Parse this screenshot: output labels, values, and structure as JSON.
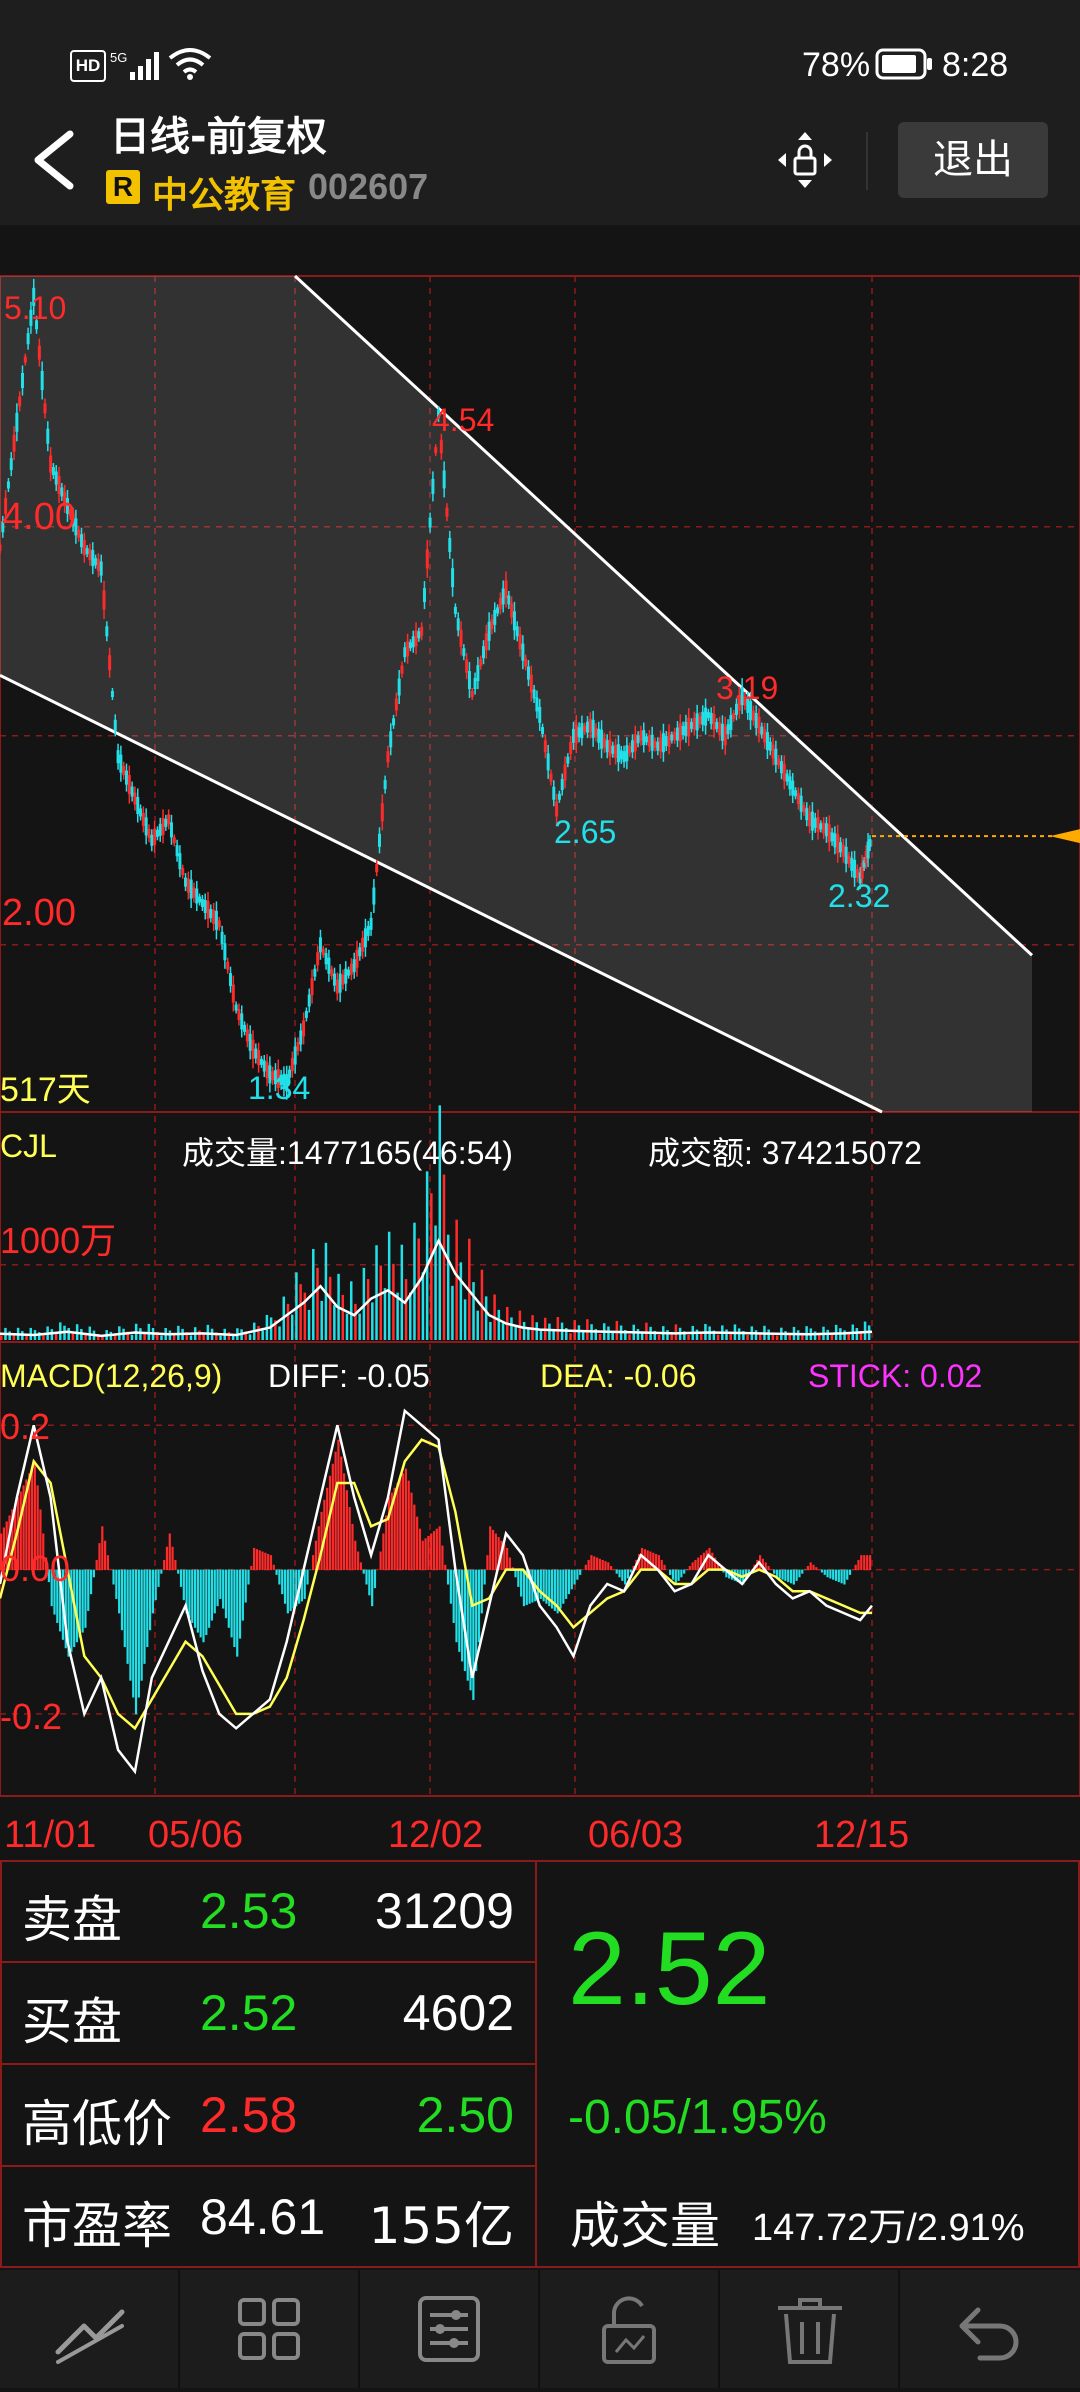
{
  "status_bar": {
    "left_icons": [
      "hd-icon",
      "5g-signal-icon",
      "wifi-icon"
    ],
    "battery_text": "78%",
    "time": "8:28"
  },
  "header": {
    "title": "日线-前复权",
    "badge": "R",
    "stock_name": "中公教育",
    "stock_code": "002607",
    "exit_label": "退出"
  },
  "colors": {
    "up": "#ff2a2a",
    "down": "#22e0e8",
    "green": "#22dd22",
    "yellow": "#ffff55",
    "magenta": "#ff33ff",
    "grid": "#8b1a1a",
    "price_line": "#ffaa00"
  },
  "chart_data": [
    {
      "type": "line",
      "title": "日线-前复权",
      "y_ticks": [
        "4.00",
        "2.00"
      ],
      "ylim": [
        1.2,
        5.2
      ],
      "annotations": [
        "5.10",
        "4.54",
        "3.19",
        "2.65",
        "2.32",
        "1.34"
      ],
      "span_label": "517天",
      "x_ticks": [
        "11/01",
        "05/06",
        "12/02",
        "06/03",
        "12/15"
      ],
      "series": [
        {
          "name": "",
          "x": [
            0,
            10,
            20,
            30,
            40,
            50,
            60,
            70,
            80,
            90,
            100,
            110,
            120,
            130,
            140,
            150,
            160,
            170,
            180,
            190,
            200,
            210,
            220,
            230,
            240,
            250,
            260,
            270,
            280,
            290,
            300,
            310,
            320,
            330,
            340,
            350,
            360,
            370,
            380,
            390,
            400,
            410,
            420,
            430,
            440,
            450,
            460,
            470,
            480,
            490,
            500,
            510,
            517
          ],
          "y": [
            3.9,
            4.5,
            5.1,
            4.3,
            4.1,
            3.9,
            3.8,
            2.9,
            2.7,
            2.5,
            2.6,
            2.3,
            2.2,
            2.1,
            1.7,
            1.5,
            1.38,
            1.34,
            1.6,
            2.0,
            1.8,
            1.9,
            2.1,
            2.9,
            3.4,
            3.5,
            4.54,
            3.6,
            3.2,
            3.5,
            3.7,
            3.4,
            3.1,
            2.65,
            3.0,
            3.05,
            2.95,
            2.9,
            3.0,
            2.95,
            3.0,
            3.05,
            3.1,
            3.0,
            3.19,
            3.05,
            2.9,
            2.75,
            2.6,
            2.55,
            2.45,
            2.32,
            2.52
          ]
        }
      ],
      "channel": {
        "upper": {
          "start": [
            0,
            5.25
          ],
          "end": [
            517,
            1.95
          ]
        },
        "lower": {
          "start": [
            0,
            3.05
          ],
          "end": [
            517,
            0.7
          ]
        }
      },
      "current_price": 2.52
    },
    {
      "type": "bar",
      "title": "CJL",
      "volume_label": "成交量:1477165(46:54)",
      "amount_label": "成交额: 374215072",
      "y_tick": "1000万",
      "ylim": [
        0,
        2500
      ],
      "x": [
        0,
        20,
        40,
        60,
        80,
        100,
        120,
        140,
        160,
        180,
        190,
        200,
        210,
        220,
        230,
        240,
        250,
        260,
        270,
        280,
        290,
        300,
        310,
        320,
        340,
        360,
        380,
        400,
        420,
        440,
        460,
        480,
        500,
        517
      ],
      "values": [
        150,
        120,
        200,
        100,
        180,
        140,
        160,
        120,
        300,
        900,
        1300,
        800,
        600,
        1000,
        1200,
        900,
        1500,
        2400,
        1600,
        1100,
        600,
        400,
        300,
        250,
        220,
        200,
        180,
        160,
        180,
        170,
        150,
        140,
        160,
        200
      ]
    },
    {
      "type": "bar",
      "title": "MACD(12,26,9)",
      "diff_label": "DIFF: -0.05",
      "dea_label": "DEA: -0.06",
      "stick_label": "STICK: 0.02",
      "y_ticks": [
        "0.2",
        "0.00",
        "-0.2"
      ],
      "ylim": [
        -0.3,
        0.26
      ],
      "x": [
        0,
        10,
        20,
        30,
        40,
        50,
        60,
        70,
        80,
        90,
        100,
        110,
        120,
        130,
        140,
        150,
        160,
        170,
        180,
        190,
        200,
        210,
        220,
        230,
        240,
        250,
        260,
        270,
        280,
        290,
        300,
        310,
        320,
        330,
        340,
        350,
        360,
        370,
        380,
        390,
        400,
        410,
        420,
        430,
        440,
        450,
        460,
        470,
        480,
        490,
        500,
        510,
        517
      ],
      "stick": [
        0.05,
        0.1,
        0.15,
        -0.05,
        -0.12,
        -0.08,
        0.06,
        -0.06,
        -0.2,
        -0.06,
        0.05,
        -0.06,
        -0.1,
        -0.04,
        -0.12,
        0.03,
        0.02,
        -0.06,
        -0.04,
        0.08,
        0.18,
        0.04,
        -0.05,
        0.1,
        0.14,
        0.04,
        0.06,
        -0.1,
        -0.18,
        0.06,
        0.03,
        -0.05,
        -0.04,
        -0.06,
        -0.02,
        0.02,
        0.01,
        -0.02,
        0.03,
        0.02,
        -0.02,
        0.01,
        0.03,
        -0.01,
        -0.02,
        0.02,
        -0.01,
        -0.02,
        0.01,
        -0.01,
        -0.02,
        0.02,
        0.02
      ],
      "diff": [
        -0.02,
        0.1,
        0.2,
        0.1,
        -0.1,
        -0.2,
        -0.15,
        -0.25,
        -0.28,
        -0.15,
        -0.1,
        -0.05,
        -0.14,
        -0.2,
        -0.22,
        -0.2,
        -0.18,
        -0.1,
        0.0,
        0.1,
        0.2,
        0.1,
        0.02,
        0.1,
        0.22,
        0.2,
        0.18,
        0.0,
        -0.15,
        -0.05,
        0.05,
        0.02,
        -0.05,
        -0.08,
        -0.12,
        -0.05,
        -0.02,
        -0.03,
        0.02,
        0.0,
        -0.03,
        -0.02,
        0.02,
        0.0,
        -0.02,
        0.01,
        -0.02,
        -0.04,
        -0.03,
        -0.05,
        -0.06,
        -0.07,
        -0.05
      ],
      "dea": [
        -0.04,
        0.05,
        0.15,
        0.12,
        0.0,
        -0.12,
        -0.15,
        -0.2,
        -0.22,
        -0.18,
        -0.14,
        -0.1,
        -0.12,
        -0.16,
        -0.2,
        -0.2,
        -0.19,
        -0.15,
        -0.07,
        0.02,
        0.12,
        0.12,
        0.06,
        0.07,
        0.15,
        0.18,
        0.17,
        0.08,
        -0.05,
        -0.04,
        0.0,
        0.0,
        -0.03,
        -0.05,
        -0.08,
        -0.06,
        -0.04,
        -0.03,
        0.0,
        0.0,
        -0.02,
        -0.02,
        0.0,
        0.0,
        -0.01,
        0.0,
        -0.01,
        -0.03,
        -0.03,
        -0.04,
        -0.05,
        -0.06,
        -0.06
      ]
    }
  ],
  "quote_panel": {
    "rows": [
      {
        "label": "卖盘",
        "price": "2.53",
        "qty": "31209"
      },
      {
        "label": "买盘",
        "price": "2.52",
        "qty": "4602"
      },
      {
        "label": "高低价",
        "price": "2.58",
        "qty": "2.50"
      },
      {
        "label": "市盈率",
        "price": "84.61",
        "qty": "155亿"
      }
    ],
    "last_price": "2.52",
    "change": "-0.05/1.95%",
    "volume_label": "成交量",
    "volume_value": "147.72万/2.91%"
  },
  "navbar": {
    "icons": [
      "draw-line-icon",
      "grid-icon",
      "settings-sliders-icon",
      "unlock-icon",
      "trash-icon",
      "undo-icon"
    ]
  }
}
